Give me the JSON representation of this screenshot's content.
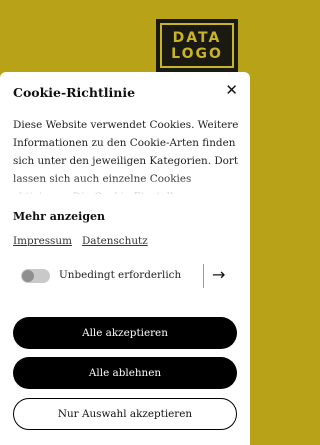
{
  "logo": {
    "line1": "DATA",
    "line2": "LOGO"
  },
  "dialog": {
    "title": "Cookie-Richtlinie",
    "close_icon": "close-icon",
    "description": "Diese Website verwendet Cookies. Weitere Informationen zu den Cookie-Arten finden sich unter den jeweiligen Kategorien. Dort lassen sich auch einzelne Cookies aktivieren. Die Cookie-Einstellungen können jederzeit über",
    "show_more": "Mehr anzeigen",
    "links": {
      "imprint": "Impressum",
      "privacy": "Datenschutz"
    },
    "category": {
      "label": "Unbedingt erforderlich",
      "arrow_icon": "arrow-right-icon"
    },
    "buttons": {
      "accept_all": "Alle akzeptieren",
      "reject_all": "Alle ablehnen",
      "accept_selection": "Nur Auswahl akzeptieren"
    }
  },
  "colors": {
    "background": "#b8a318",
    "logo_accent": "#c9b326",
    "button_dark": "#000000"
  }
}
